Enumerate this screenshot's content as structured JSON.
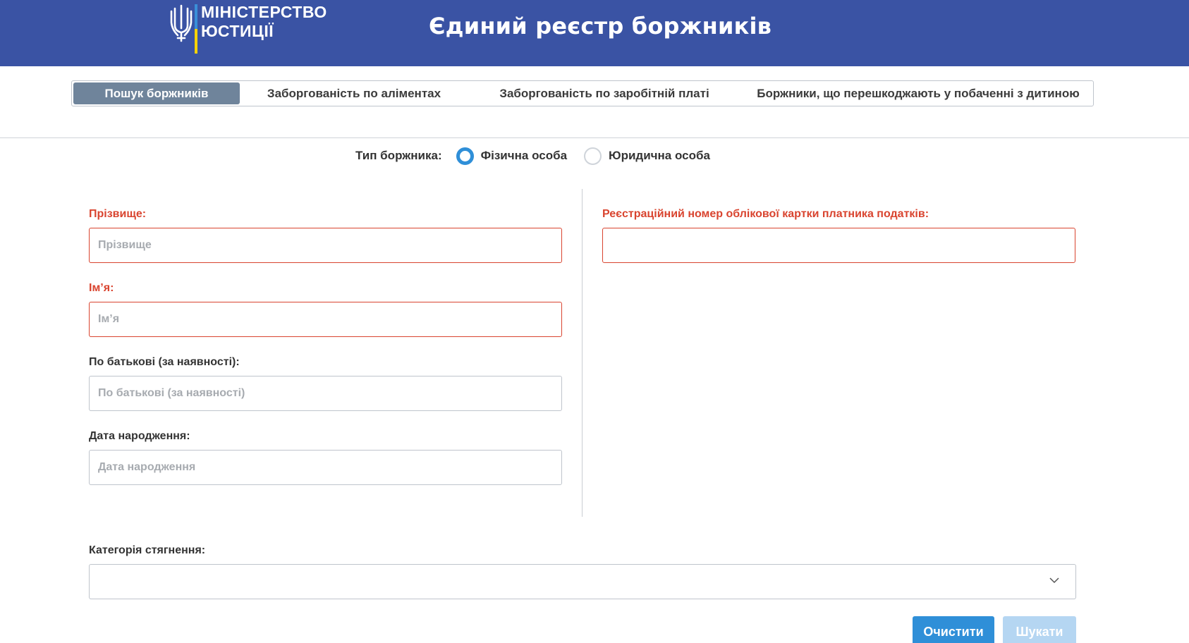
{
  "header": {
    "ministry_line1": "МІНІСТЕРСТВО",
    "ministry_line2": "ЮСТИЦІЇ",
    "title": "Єдиний реєстр боржників"
  },
  "tabs": [
    {
      "label": "Пошук боржників",
      "active": true
    },
    {
      "label": "Заборгованість по аліментах",
      "active": false
    },
    {
      "label": "Заборгованість по заробітній платі",
      "active": false
    },
    {
      "label": "Боржники, що перешкоджають у побаченні з дитиною",
      "active": false
    }
  ],
  "debtor_type": {
    "label": "Тип боржника:",
    "options": [
      {
        "label": "Фізична особа",
        "selected": true
      },
      {
        "label": "Юридична особа",
        "selected": false
      }
    ]
  },
  "form": {
    "surname": {
      "label": "Прізвище:",
      "placeholder": "Прізвище",
      "required": true
    },
    "name": {
      "label": "Ім’я:",
      "placeholder": "Ім’я",
      "required": true
    },
    "patronymic": {
      "label": "По батькові (за наявності):",
      "placeholder": "По батькові (за наявності)",
      "required": false
    },
    "birth_date": {
      "label": "Дата народження:",
      "placeholder": "Дата народження",
      "required": false
    },
    "tax_number": {
      "label": "Реєстраційний номер облікової картки платника податків:",
      "placeholder": "",
      "required": true
    },
    "category": {
      "label": "Категорія стягнення:",
      "value": ""
    }
  },
  "buttons": {
    "clear": "Очистити",
    "search": "Шукати"
  },
  "colors": {
    "header_bg": "#3a53a4",
    "active_tab": "#6f849b",
    "required": "#d9442f",
    "primary": "#2f8fd8",
    "disabled": "#b5d6f2"
  }
}
